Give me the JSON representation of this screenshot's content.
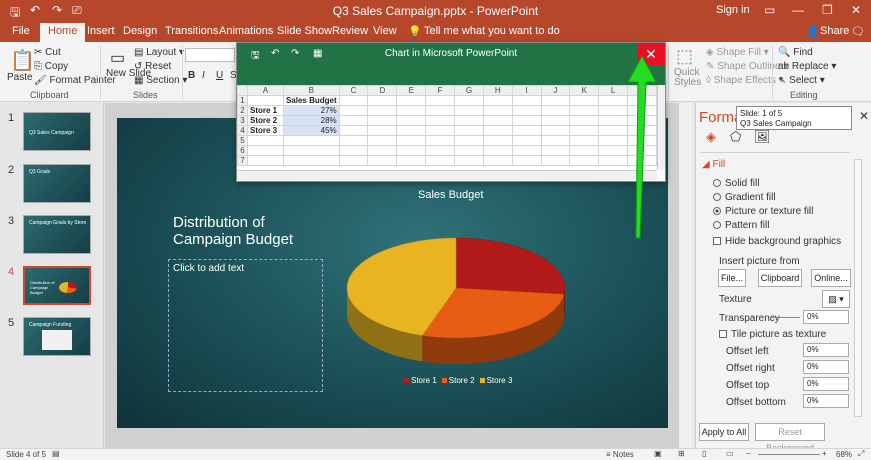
{
  "window": {
    "title": "Q3 Sales Campaign.pptx - PowerPoint",
    "sign_in": "Sign in"
  },
  "tabs": [
    "File",
    "Home",
    "Insert",
    "Design",
    "Transitions",
    "Animations",
    "Slide Show",
    "Review",
    "View"
  ],
  "tell_me": "Tell me what you want to do",
  "share": "Share",
  "ribbon": {
    "paste": "Paste",
    "cut": "Cut",
    "copy": "Copy",
    "format_painter": "Format Painter",
    "clipboard_label": "Clipboard",
    "new_slide": "New Slide",
    "layout": "Layout",
    "reset": "Reset",
    "section": "Section",
    "slides_label": "Slides",
    "quick_styles": "Quick Styles",
    "shape_fill": "Shape Fill",
    "shape_outline": "Shape Outline",
    "shape_effects": "Shape Effects",
    "find": "Find",
    "replace": "Replace",
    "select": "Select",
    "editing_label": "Editing"
  },
  "thumbnails": [
    {
      "num": "1",
      "title": "Q3 Sales Campaign"
    },
    {
      "num": "2",
      "title": "Q3 Goals"
    },
    {
      "num": "3",
      "title": "Campaign Goals by Store"
    },
    {
      "num": "4",
      "title": "Distribution of Campaign Budget"
    },
    {
      "num": "5",
      "title": "Campaign Funding"
    }
  ],
  "selected_slide": "4",
  "slide": {
    "title_line1": "Distribution of",
    "title_line2": "Campaign Budget",
    "placeholder": "Click to add text",
    "chart_title": "Sales Budget"
  },
  "chart_data": {
    "type": "pie",
    "title": "Sales Budget",
    "categories": [
      "Store 1",
      "Store 2",
      "Store 3"
    ],
    "values": [
      0.27,
      0.28,
      0.45
    ],
    "colors": [
      "#b31b1b",
      "#e85d13",
      "#e8b421"
    ]
  },
  "excel": {
    "title": "Chart in Microsoft PowerPoint",
    "close": "✕",
    "columns": [
      "A",
      "B",
      "C",
      "D",
      "E",
      "F",
      "G",
      "H",
      "I",
      "J",
      "K",
      "L",
      "M"
    ],
    "rows": [
      {
        "n": "1",
        "a": "",
        "b": "Sales Budget"
      },
      {
        "n": "2",
        "a": "Store 1",
        "b": "27%"
      },
      {
        "n": "3",
        "a": "Store 2",
        "b": "28%"
      },
      {
        "n": "4",
        "a": "Store 3",
        "b": "45%"
      },
      {
        "n": "5",
        "a": "",
        "b": ""
      },
      {
        "n": "6",
        "a": "",
        "b": ""
      },
      {
        "n": "7",
        "a": "",
        "b": ""
      }
    ]
  },
  "format_pane": {
    "title": "Format",
    "tooltip_line1": "Slide: 1 of 5",
    "tooltip_line2": "Q3 Sales Campaign",
    "fill": "Fill",
    "solid": "Solid fill",
    "gradient": "Gradient fill",
    "picture": "Picture or texture fill",
    "pattern": "Pattern fill",
    "hide_bg": "Hide background graphics",
    "insert_from": "Insert picture from",
    "file": "File...",
    "clipboard": "Clipboard",
    "online": "Online...",
    "texture": "Texture",
    "transparency": "Transparency",
    "transparency_val": "0%",
    "tile": "Tile picture as texture",
    "offset_left": "Offset left",
    "offset_right": "Offset right",
    "offset_top": "Offset top",
    "offset_bottom": "Offset bottom",
    "offset_left_val": "0%",
    "offset_right_val": "0%",
    "offset_top_val": "0%",
    "offset_bottom_val": "0%",
    "apply_all": "Apply to All",
    "reset_bg": "Reset Background"
  },
  "status": {
    "slide_of": "Slide 4 of 5",
    "notes": "Notes",
    "zoom": "68%"
  }
}
